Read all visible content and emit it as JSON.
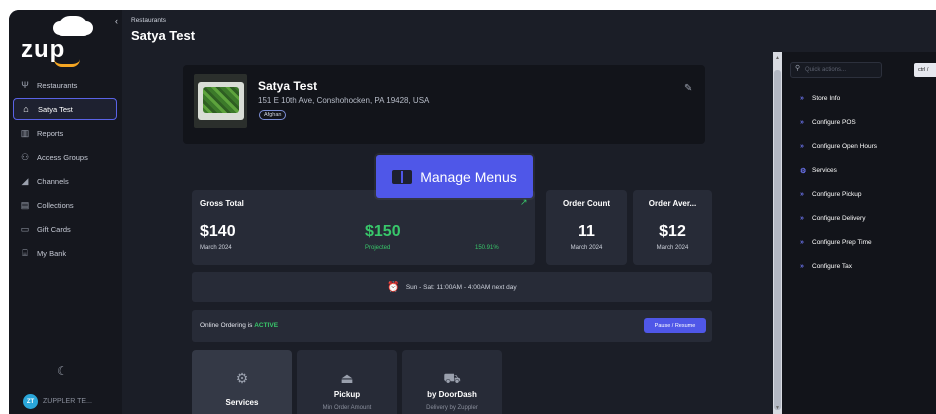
{
  "app": {
    "logo_text": "zup"
  },
  "sidebar": {
    "collapse_icon": "chevron-left-icon",
    "items": [
      {
        "label": "Restaurants",
        "icon": "fork-knife-icon"
      },
      {
        "label": "Satya Test",
        "icon": "home-icon",
        "active": true
      },
      {
        "label": "Reports",
        "icon": "chart-icon"
      },
      {
        "label": "Access Groups",
        "icon": "users-icon"
      },
      {
        "label": "Channels",
        "icon": "satellite-icon"
      },
      {
        "label": "Collections",
        "icon": "collection-icon"
      },
      {
        "label": "Gift Cards",
        "icon": "card-icon"
      },
      {
        "label": "My Bank",
        "icon": "bank-icon"
      }
    ],
    "user": {
      "initials": "ZT",
      "name": "ZUPPLER TE..."
    }
  },
  "header": {
    "breadcrumb": "Restaurants",
    "title": "Satya Test"
  },
  "store": {
    "name": "Satya Test",
    "address": "151 E 10th Ave, Conshohocken, PA 19428, USA",
    "cuisine": "Afghan"
  },
  "manage_menus": {
    "label": "Manage Menus"
  },
  "kpis": {
    "gross_total": {
      "label": "Gross Total",
      "value": "$140",
      "period": "March 2024",
      "projected_value": "$150",
      "projected_label": "Projected",
      "projected_pct": "150.91%"
    },
    "order_count": {
      "label": "Order Count",
      "value": "11",
      "period": "March 2024"
    },
    "order_avg": {
      "label": "Order Aver...",
      "value": "$12",
      "period": "March 2024"
    }
  },
  "hours": {
    "text": "Sun - Sat: 11:00AM - 4:00AM next day"
  },
  "ordering": {
    "prefix": "Online Ordering is ",
    "status": "ACTIVE",
    "button": "Pause / Resume"
  },
  "services": [
    {
      "label": "Services",
      "sub": ""
    },
    {
      "label": "Pickup",
      "sub": "Min Order Amount"
    },
    {
      "label": "by DoorDash",
      "sub": "Delivery by Zuppler"
    }
  ],
  "quick_actions": {
    "search_placeholder": "Quick actions...",
    "shortcut": "ctrl /",
    "items": [
      "Store Info",
      "Configure POS",
      "Configure Open Hours",
      "Services",
      "Configure Pickup",
      "Configure Delivery",
      "Configure Prep Time",
      "Configure Tax"
    ]
  },
  "colors": {
    "accent": "#4f57e8",
    "positive": "#38c76a",
    "background": "#1b1e27"
  }
}
